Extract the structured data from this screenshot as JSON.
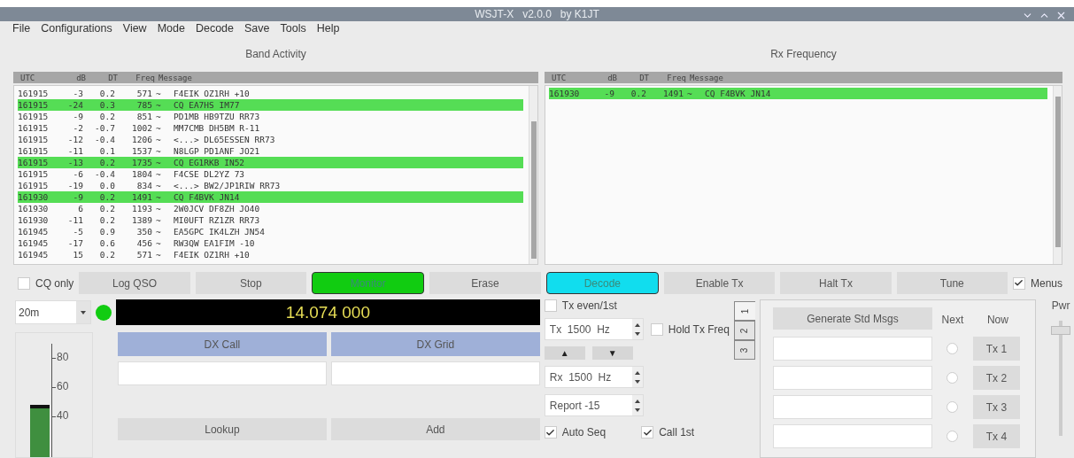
{
  "window": {
    "title": "WSJT-X   v2.0.0   by K1JT"
  },
  "menu": [
    "File",
    "Configurations",
    "View",
    "Mode",
    "Decode",
    "Save",
    "Tools",
    "Help"
  ],
  "band_activity": {
    "title": "Band Activity",
    "columns": [
      "UTC",
      "dB",
      "DT",
      "Freq",
      "Message"
    ],
    "rows": [
      {
        "utc": "161915",
        "db": "-3",
        "dt": "0.2",
        "freq": "571",
        "sep": "~",
        "message": "F4EIK OZ1RH +10",
        "highlighted": false
      },
      {
        "utc": "161915",
        "db": "-24",
        "dt": "0.3",
        "freq": "785",
        "sep": "~",
        "message": "CQ EA7HS IM77",
        "highlighted": true
      },
      {
        "utc": "161915",
        "db": "-9",
        "dt": "0.2",
        "freq": "851",
        "sep": "~",
        "message": "PD1MB HB9TZU RR73",
        "highlighted": false
      },
      {
        "utc": "161915",
        "db": "-2",
        "dt": "-0.7",
        "freq": "1002",
        "sep": "~",
        "message": "MM7CMB DH5BM R-11",
        "highlighted": false
      },
      {
        "utc": "161915",
        "db": "-12",
        "dt": "-0.4",
        "freq": "1206",
        "sep": "~",
        "message": "<...> DL65ESSEN RR73",
        "highlighted": false
      },
      {
        "utc": "161915",
        "db": "-11",
        "dt": "0.1",
        "freq": "1537",
        "sep": "~",
        "message": "N8LGP PD1ANF JO21",
        "highlighted": false
      },
      {
        "utc": "161915",
        "db": "-13",
        "dt": "0.2",
        "freq": "1735",
        "sep": "~",
        "message": "CQ EG1RKB IN52",
        "highlighted": true
      },
      {
        "utc": "161915",
        "db": "-6",
        "dt": "-0.4",
        "freq": "1804",
        "sep": "~",
        "message": "F4CSE DL2YZ 73",
        "highlighted": false
      },
      {
        "utc": "161915",
        "db": "-19",
        "dt": "0.0",
        "freq": "834",
        "sep": "~",
        "message": "<...> BW2/JP1RIW RR73",
        "highlighted": false
      },
      {
        "utc": "161930",
        "db": "-9",
        "dt": "0.2",
        "freq": "1491",
        "sep": "~",
        "message": "CQ F4BVK JN14",
        "highlighted": true
      },
      {
        "utc": "161930",
        "db": "6",
        "dt": "0.2",
        "freq": "1193",
        "sep": "~",
        "message": "2W0JCV DF8ZH JO40",
        "highlighted": false
      },
      {
        "utc": "161930",
        "db": "-11",
        "dt": "0.2",
        "freq": "1389",
        "sep": "~",
        "message": "MI0UFT RZ1ZR RR73",
        "highlighted": false
      },
      {
        "utc": "161945",
        "db": "-5",
        "dt": "0.9",
        "freq": "350",
        "sep": "~",
        "message": "EA5GPC IK4LZH JN54",
        "highlighted": false
      },
      {
        "utc": "161945",
        "db": "-17",
        "dt": "0.6",
        "freq": "456",
        "sep": "~",
        "message": "RW3QW EA1FIM -10",
        "highlighted": false
      },
      {
        "utc": "161945",
        "db": "15",
        "dt": "0.2",
        "freq": "571",
        "sep": "~",
        "message": "F4EIK OZ1RH +10",
        "highlighted": false
      }
    ]
  },
  "rx_frequency": {
    "title": "Rx Frequency",
    "columns": [
      "UTC",
      "dB",
      "DT",
      "Freq",
      "Message"
    ],
    "rows": [
      {
        "utc": "161930",
        "db": "-9",
        "dt": "0.2",
        "freq": "1491",
        "sep": "~",
        "message": "CQ F4BVK JN14",
        "highlighted": true
      }
    ]
  },
  "cq_only": {
    "label": "CQ only",
    "checked": false
  },
  "buttons": [
    {
      "label": "Log QSO",
      "on": false
    },
    {
      "label": "Stop",
      "on": false
    },
    {
      "label": "Monitor",
      "on": true,
      "color": "#11cc11"
    },
    {
      "label": "Erase",
      "on": false
    },
    {
      "label": "Decode",
      "on": true,
      "color": "#11ddee"
    },
    {
      "label": "Enable Tx",
      "on": false
    },
    {
      "label": "Halt Tx",
      "on": false
    },
    {
      "label": "Tune",
      "on": false
    }
  ],
  "menus_toggle": {
    "label": "Menus",
    "checked": true
  },
  "band": {
    "value": "20m"
  },
  "frequency": "14.074 000",
  "meter": {
    "ticks": [
      "80",
      "60",
      "40"
    ],
    "level": 0.45
  },
  "dx_call": {
    "label": "DX Call"
  },
  "dx_grid": {
    "label": "DX Grid"
  },
  "lookup": "Lookup",
  "add": "Add",
  "tx_even": {
    "label": "Tx even/1st",
    "checked": false
  },
  "tx_freq": {
    "value": "Tx  1500  Hz"
  },
  "hold_tx": {
    "label": "Hold Tx Freq",
    "checked": false
  },
  "shift_buttons": [
    "▲",
    "▼"
  ],
  "rx_freq": {
    "value": "Rx  1500  Hz"
  },
  "report": {
    "value": "Report -15"
  },
  "auto_seq": {
    "label": "Auto Seq",
    "checked": true
  },
  "call_1st": {
    "label": "Call 1st",
    "checked": true
  },
  "tabs": [
    {
      "label": "1",
      "selected": true
    },
    {
      "label": "2",
      "selected": false
    },
    {
      "label": "3",
      "selected": false
    }
  ],
  "generate": "Generate Std Msgs",
  "next_label": "Next",
  "now_label": "Now",
  "tx_rows": [
    {
      "button": "Tx 1",
      "selected": false
    },
    {
      "button": "Tx 2",
      "selected": false
    },
    {
      "button": "Tx 3",
      "selected": false
    },
    {
      "button": "Tx 4",
      "selected": false
    }
  ],
  "pwr": {
    "label": "Pwr",
    "level": 0.95
  }
}
